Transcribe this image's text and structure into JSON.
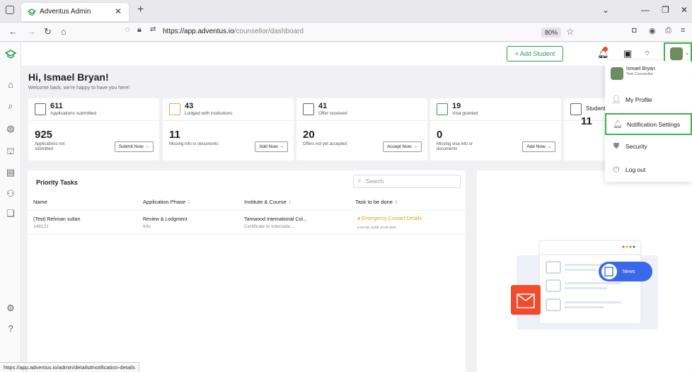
{
  "browser": {
    "tab_title": "Adventus Admin",
    "url_host": "https://app.adventus.io",
    "url_path": "/counsellor/dashboard",
    "zoom": "80%",
    "status_url": "https://app.adventus.io/admin/details#notification-details"
  },
  "header": {
    "add_student_label": "+ Add Student"
  },
  "greeting": {
    "title": "Hi, Ismael Bryan!",
    "subtitle": "Welcome back, we're happy to have you here!"
  },
  "cards": [
    {
      "top_num": "611",
      "top_label": "Applications submitted",
      "big_num": "925",
      "desc": "Applications not submitted",
      "button": "Submit Now →"
    },
    {
      "top_num": "43",
      "top_label": "Lodged with institutions",
      "big_num": "11",
      "desc": "Missing info or documents",
      "button": "Add Now →"
    },
    {
      "top_num": "41",
      "top_label": "Offer received",
      "big_num": "20",
      "desc": "Offers not yet accepted",
      "button": "Accept Now →"
    },
    {
      "top_num": "19",
      "top_label": "Visa granted",
      "big_num": "0",
      "desc": "Missing visa info or documents",
      "button": "Add Now →"
    },
    {
      "top_num": "",
      "top_label": "Student",
      "big_num": "11",
      "desc": "",
      "button": ""
    }
  ],
  "tasks": {
    "title": "Priority Tasks",
    "search_placeholder": "Search",
    "columns": [
      "Name",
      "Application Phase",
      "Institute & Course",
      "Task to be done"
    ],
    "rows": [
      {
        "name": "(Test) Rehman sultan",
        "id": "148121",
        "phase": "Review & Lodgment",
        "phase_sub": "Info",
        "institute": "Tamwood International Col...",
        "course": "Certificate In Internatio...",
        "task": "● Emergency Contact Details",
        "task_date": "6:19 AM, JUNE 10 08 2023"
      }
    ]
  },
  "news": {
    "label": "News"
  },
  "menu": {
    "user_name": "Ismael Bryan",
    "user_role": "Test Counsellor",
    "items": [
      {
        "label": "My Profile",
        "icon": "person-icon"
      },
      {
        "label": "Notification Settings",
        "icon": "bell-icon"
      },
      {
        "label": "Security",
        "icon": "shield-icon"
      },
      {
        "label": "Log out",
        "icon": "power-icon"
      }
    ]
  },
  "colors": {
    "brand_green": "#2d9b5c",
    "highlight_green": "#3bb54a",
    "warning_orange": "#f29c11",
    "alert_red": "#f24b2e"
  }
}
